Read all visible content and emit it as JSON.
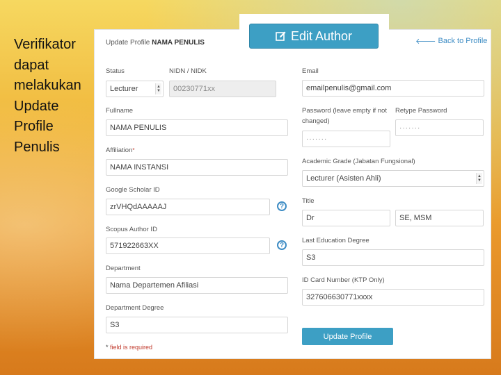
{
  "slide": {
    "lines": [
      "Verifikator",
      "dapat",
      "melakukan",
      "Update",
      "Profile",
      "Penulis"
    ]
  },
  "header": {
    "edit_button": "Edit Author",
    "title_prefix": "Update Profile",
    "title_name": "NAMA PENULIS",
    "back_link": "Back to Profile"
  },
  "form": {
    "status": {
      "label": "Status",
      "value": "Lecturer"
    },
    "nidn": {
      "label": "NIDN / NIDK",
      "value": "00230771xx"
    },
    "email": {
      "label": "Email",
      "value": "emailpenulis@gmail.com"
    },
    "fullname": {
      "label": "Fullname",
      "value": "NAMA PENULIS"
    },
    "password": {
      "label": "Password (leave empty if not changed)",
      "value": "·······"
    },
    "retype": {
      "label": "Retype Password",
      "value": "·······"
    },
    "affiliation": {
      "label": "Affiliation",
      "value": "NAMA INSTANSI"
    },
    "academic_grade": {
      "label": "Academic Grade (Jabatan Fungsional)",
      "value": "Lecturer (Asisten Ahli)"
    },
    "scholar": {
      "label": "Google Scholar ID",
      "value": "zrVHQdAAAAAJ"
    },
    "title": {
      "label": "Title",
      "front": "Dr",
      "back": "SE, MSM"
    },
    "scopus": {
      "label": "Scopus Author ID",
      "value": "571922663XX"
    },
    "last_degree": {
      "label": "Last Education Degree",
      "value": "S3"
    },
    "department": {
      "label": "Department",
      "value": "Nama Departemen Afiliasi"
    },
    "id_card": {
      "label": "ID Card Number (KTP Only)",
      "value": "327606630771xxxx"
    },
    "dept_degree": {
      "label": "Department Degree",
      "value": "S3"
    },
    "update_button": "Update Profile",
    "required_note": "field is required"
  },
  "icons": {
    "edit": "edit-icon",
    "back": "arrow-left-icon",
    "help": "question-circle-icon"
  }
}
